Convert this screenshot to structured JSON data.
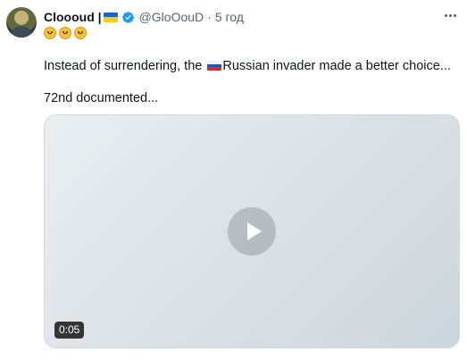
{
  "author": {
    "name": "Cloooud |",
    "handle": "@GloOouD",
    "separator": "·",
    "time": "5 год"
  },
  "tweet": {
    "line1_before": "Instead of surrendering, the ",
    "line1_after": "Russian invader made a better choice...",
    "line2": "72nd documented..."
  },
  "media": {
    "duration": "0:05"
  },
  "icons": [
    "avatar",
    "ukraine-flag-icon",
    "verified-badge-icon",
    "more-icon",
    "emoji-icon",
    "russia-flag-icon",
    "play-icon"
  ],
  "colors": {
    "verified_blue": "#1d9bf0",
    "secondary_text": "#536471"
  }
}
